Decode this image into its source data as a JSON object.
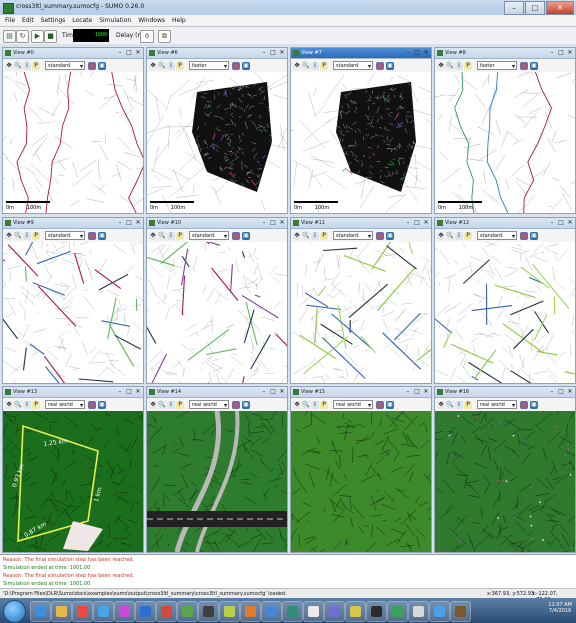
{
  "window": {
    "title": "cross3ltl_summary.sumocfg - SUMO 0.26.0"
  },
  "menu": [
    "File",
    "Edit",
    "Settings",
    "Locate",
    "Simulation",
    "Windows",
    "Help"
  ],
  "toolbar": {
    "time_label": "Time:",
    "time_value": "1000",
    "delay_label": "Delay (ms):",
    "delay_value": "0"
  },
  "views": [
    {
      "title": "View #0",
      "scheme": "standard",
      "scale": "100m",
      "scale_start": "0m",
      "kind": "light",
      "active": false
    },
    {
      "title": "View #6",
      "scheme": "faster standard",
      "scale": "100m",
      "scale_start": "0m",
      "kind": "dense",
      "active": false
    },
    {
      "title": "View #7",
      "scheme": "standard",
      "scale": "100m",
      "scale_start": "0m",
      "kind": "dense",
      "active": true
    },
    {
      "title": "View #8",
      "scheme": "faster standard",
      "scale": "100m",
      "scale_start": "0m",
      "kind": "light",
      "active": false
    },
    {
      "title": "View #9",
      "scheme": "standard",
      "kind": "colored",
      "active": false
    },
    {
      "title": "View #10",
      "scheme": "standard",
      "kind": "colored",
      "active": false
    },
    {
      "title": "View #11",
      "scheme": "standard",
      "kind": "colored",
      "active": false
    },
    {
      "title": "View #12",
      "scheme": "standard",
      "kind": "colored",
      "active": false
    },
    {
      "title": "View #13",
      "scheme": "real world",
      "kind": "green1",
      "labels": [
        "1.25 km",
        "0.93 km",
        "0.87 km",
        "1 km"
      ],
      "active": false
    },
    {
      "title": "View #14",
      "scheme": "real world",
      "kind": "green2",
      "active": false
    },
    {
      "title": "View #15",
      "scheme": "real world",
      "kind": "green3",
      "active": false
    },
    {
      "title": "View #16",
      "scheme": "real world",
      "kind": "green4",
      "active": false
    }
  ],
  "messages": [
    {
      "text": "Reason: The final simulation step has been reached.",
      "color": "#c0392b"
    },
    {
      "text": "Simulation ended at time: 1001.00",
      "color": "#1f7a1f"
    },
    {
      "text": "Reason: The final simulation step has been reached.",
      "color": "#c0392b"
    },
    {
      "text": "Simulation ended at time: 1001.00",
      "color": "#1f7a1f"
    }
  ],
  "status": {
    "text": "'D:\\Program Files\\DLR\\Sumo\\docs\\examples\\sumo\\output\\cross3ltl_summary\\cross3ltl_summary.sumocfg' loaded.",
    "coord1": "x:367.93, y:572.93",
    "coord2": "x:-122.07, y:72.00"
  },
  "taskbar": {
    "time": "11:07 AM",
    "date": "7/4/2016"
  }
}
